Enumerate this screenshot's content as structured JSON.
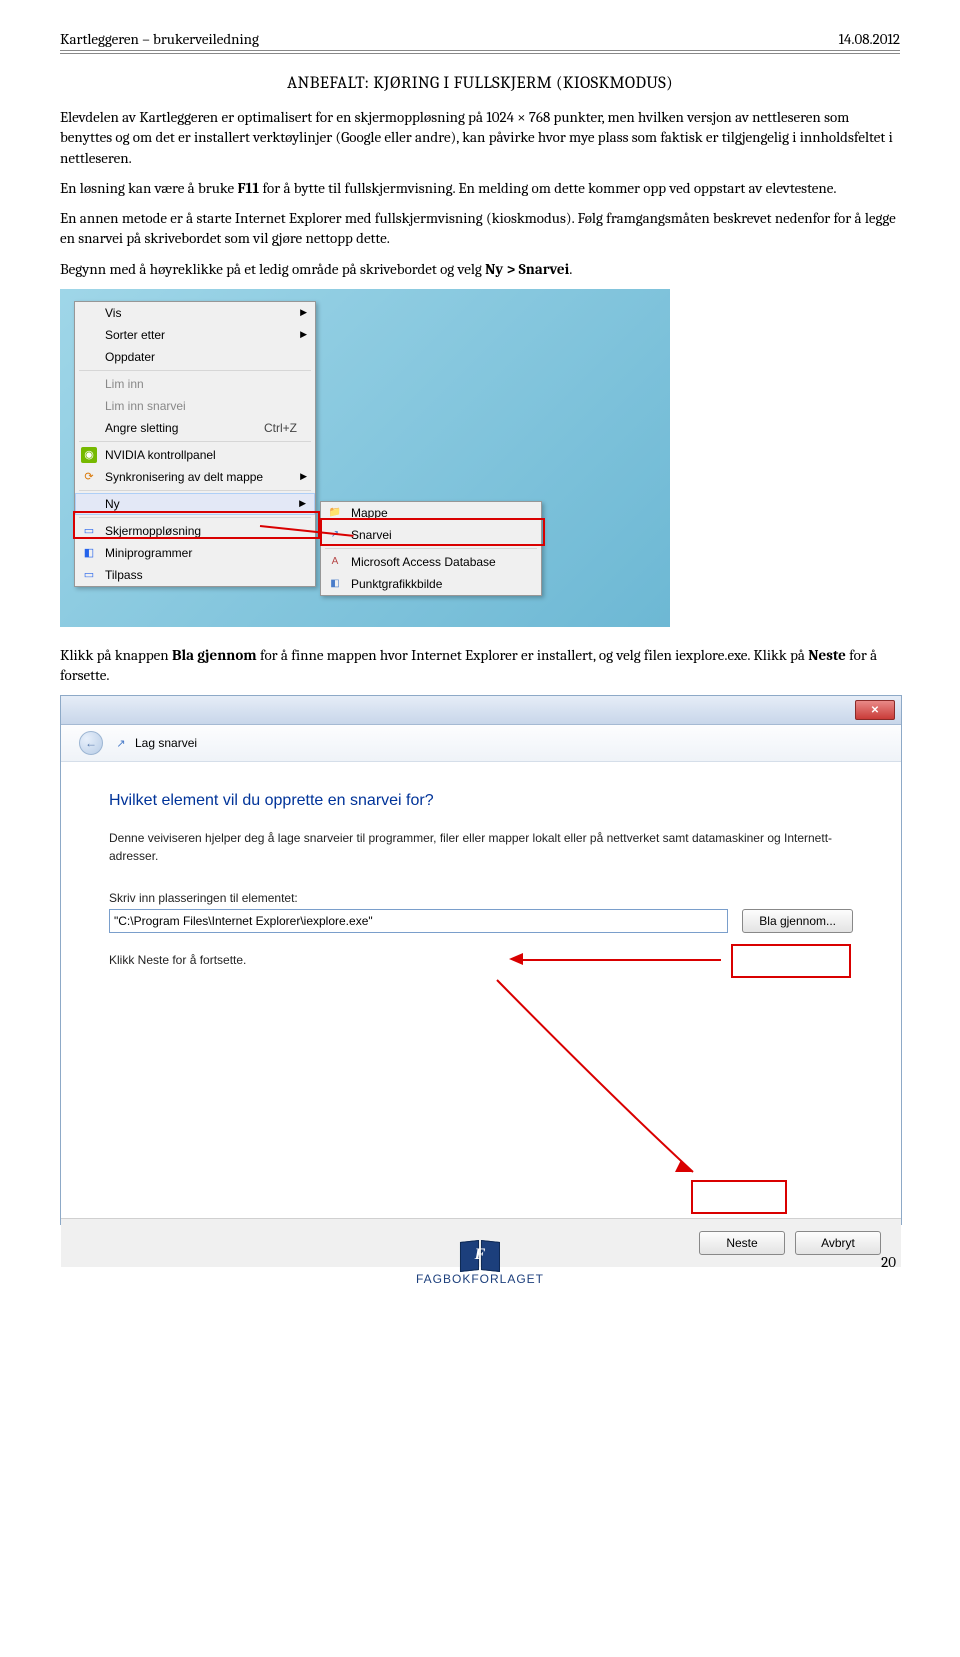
{
  "header": {
    "left": "Kartleggeren – brukerveiledning",
    "right": "14.08.2012"
  },
  "section_title": "ANBEFALT: KJØRING I FULLSKJERM (KIOSKMODUS)",
  "p1a": "Elevdelen av Kartleggeren er optimalisert for en skjermoppløsning på 1024 × 768 punkter, men hvilken versjon av nettleseren som benyttes og om det er installert verktøylinjer (Google eller andre), kan påvirke hvor mye plass som faktisk er tilgjengelig i innholdsfeltet i nettleseren.",
  "p2a": "En løsning kan være å bruke ",
  "p2b": "F11",
  "p2c": " for å bytte til fullskjermvisning. En melding om dette kommer opp ved oppstart av elevtestene.",
  "p3": "En annen metode er å starte Internet Explorer med fullskjermvisning (kioskmodus). Følg framgangsmåten beskrevet nedenfor for å legge en snarvei på skrivebordet som vil gjøre nettopp dette.",
  "p4a": "Begynn med å høyreklikke på et ledig område på skrivebordet og velg ",
  "p4b": "Ny > Snarvei",
  "p4c": ".",
  "context_menu": {
    "vis": "Vis",
    "sorter": "Sorter etter",
    "oppdater": "Oppdater",
    "lim_inn": "Lim inn",
    "lim_inn_snarvei": "Lim inn snarvei",
    "angre": "Angre sletting",
    "angre_key": "Ctrl+Z",
    "nvidia": "NVIDIA kontrollpanel",
    "synk": "Synkronisering av delt mappe",
    "ny": "Ny",
    "skjerm": "Skjermoppløsning",
    "mini": "Miniprogrammer",
    "tilpass": "Tilpass"
  },
  "submenu": {
    "mappe": "Mappe",
    "snarvei": "Snarvei",
    "access": "Microsoft Access Database",
    "punkt": "Punktgrafikkbilde"
  },
  "p5a": "Klikk på knappen ",
  "p5b": "Bla gjennom",
  "p5c": " for å finne mappen hvor Internet Explorer er installert, og velg filen iexplore.exe. Klikk på ",
  "p5d": "Neste",
  "p5e": " for å forsette.",
  "dialog": {
    "band_label": "Lag snarvei",
    "heading": "Hvilket element vil du opprette en snarvei for?",
    "desc": "Denne veiviseren hjelper deg å lage snarveier til programmer, filer eller mapper lokalt eller på nettverket samt datamaskiner og Internett-adresser.",
    "field_label": "Skriv inn plasseringen til elementet:",
    "field_value": "\"C:\\Program Files\\Internet Explorer\\iexplore.exe\"",
    "browse": "Bla gjennom...",
    "continue_hint": "Klikk Neste for å fortsette.",
    "next": "Neste",
    "cancel": "Avbryt"
  },
  "footer": {
    "page_number": "20",
    "brand": "FAGBOKFORLAGET"
  }
}
